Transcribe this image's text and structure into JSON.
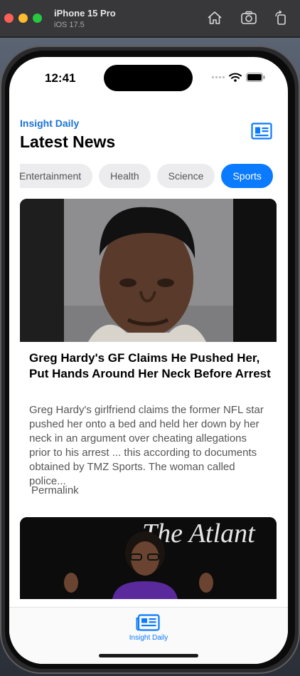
{
  "simulator": {
    "device_name": "iPhone 15 Pro",
    "os_version": "iOS 17.5",
    "icons": [
      "home-icon",
      "screenshot-icon",
      "rotate-icon"
    ]
  },
  "status_bar": {
    "time": "12:41"
  },
  "header": {
    "brand": "Insight Daily",
    "title": "Latest News",
    "profile_icon": "news-card-icon"
  },
  "categories": {
    "items": [
      "Entertainment",
      "Health",
      "Science",
      "Sports"
    ],
    "selected": "Sports"
  },
  "articles": [
    {
      "title": "Greg Hardy's GF Claims He Pushed Her, Put Hands Around Her Neck Before Arrest",
      "description": "Greg Hardy's girlfriend claims the former NFL star pushed her onto a bed and held her down by her neck in an argument over cheating allegations prior to his arrest ... this according to documents obtained by TMZ Sports. The woman called police...",
      "link_label": "Permalink",
      "image_icon": "mugshot-photo"
    },
    {
      "image_icon": "speaker-photo",
      "image_caption": "The Atlant"
    }
  ],
  "tab_bar": {
    "items": [
      {
        "label": "Insight Daily",
        "icon": "newspaper-icon"
      }
    ]
  },
  "colors": {
    "accent": "#0a7aff",
    "brand": "#1a73d9",
    "chip_bg": "#ececef",
    "text_secondary": "#555555"
  }
}
